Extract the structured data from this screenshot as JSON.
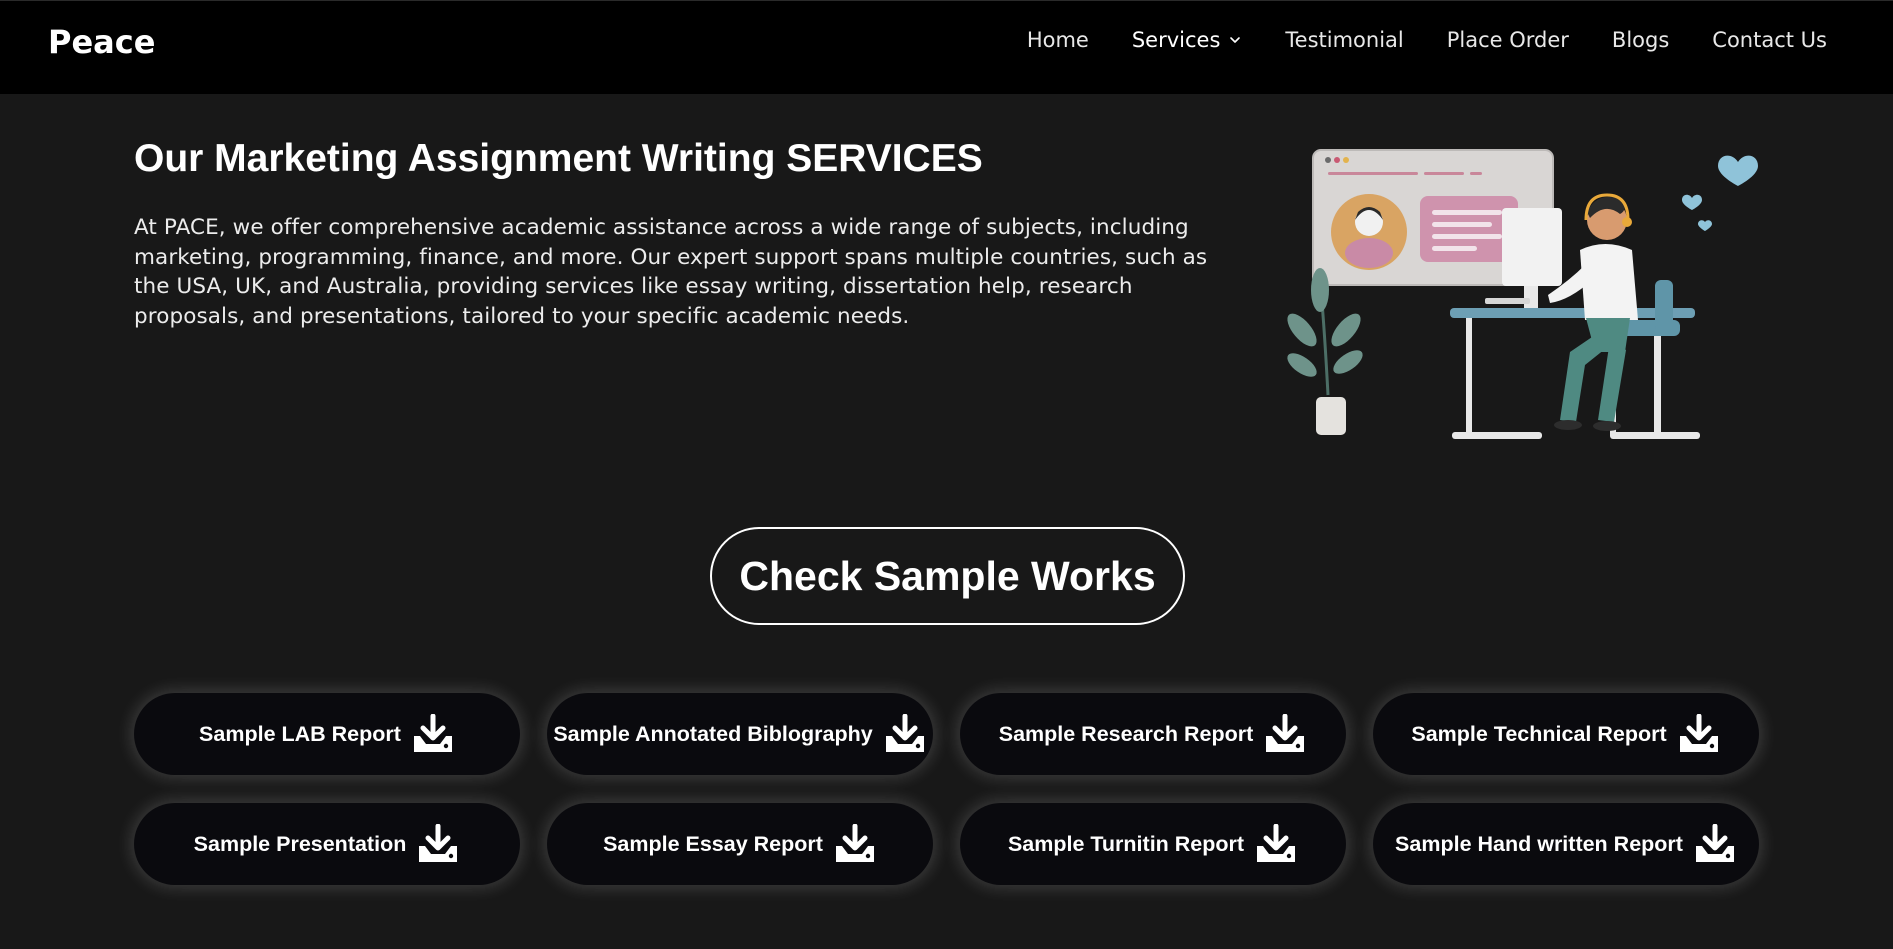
{
  "nav": {
    "brand": "Peace",
    "links": [
      {
        "label": "Home"
      },
      {
        "label": "Services",
        "has_dropdown": true,
        "icon": "chevron-down-icon"
      },
      {
        "label": "Testimonial"
      },
      {
        "label": "Place Order"
      },
      {
        "label": "Blogs"
      },
      {
        "label": "Contact Us"
      }
    ]
  },
  "hero": {
    "title": "Our Marketing Assignment Writing SERVICES",
    "text": "At PACE, we offer comprehensive academic assistance across a wide range of subjects, including marketing, programming, finance, and more. Our expert support spans multiple countries, such as the USA, UK, and Australia, providing services like essay writing, dissertation help, research proposals, and presentations, tailored to your specific academic needs.",
    "illustration": "person-at-desk-illustration"
  },
  "cta": {
    "label": "Check Sample Works"
  },
  "samples": [
    {
      "label": "Sample LAB Report",
      "icon": "download-icon"
    },
    {
      "label": "Sample Annotated Biblography",
      "icon": "download-icon"
    },
    {
      "label": "Sample Research Report",
      "icon": "download-icon"
    },
    {
      "label": "Sample Technical Report",
      "icon": "download-icon"
    },
    {
      "label": "Sample Presentation",
      "icon": "download-icon"
    },
    {
      "label": "Sample Essay Report",
      "icon": "download-icon"
    },
    {
      "label": "Sample Turnitin Report",
      "icon": "download-icon"
    },
    {
      "label": "Sample Hand written Report",
      "icon": "download-icon"
    }
  ],
  "colors": {
    "page_bg": "#181818",
    "navbar_bg": "#000000",
    "button_bg": "#0a0a0e",
    "text": "#ffffff"
  }
}
